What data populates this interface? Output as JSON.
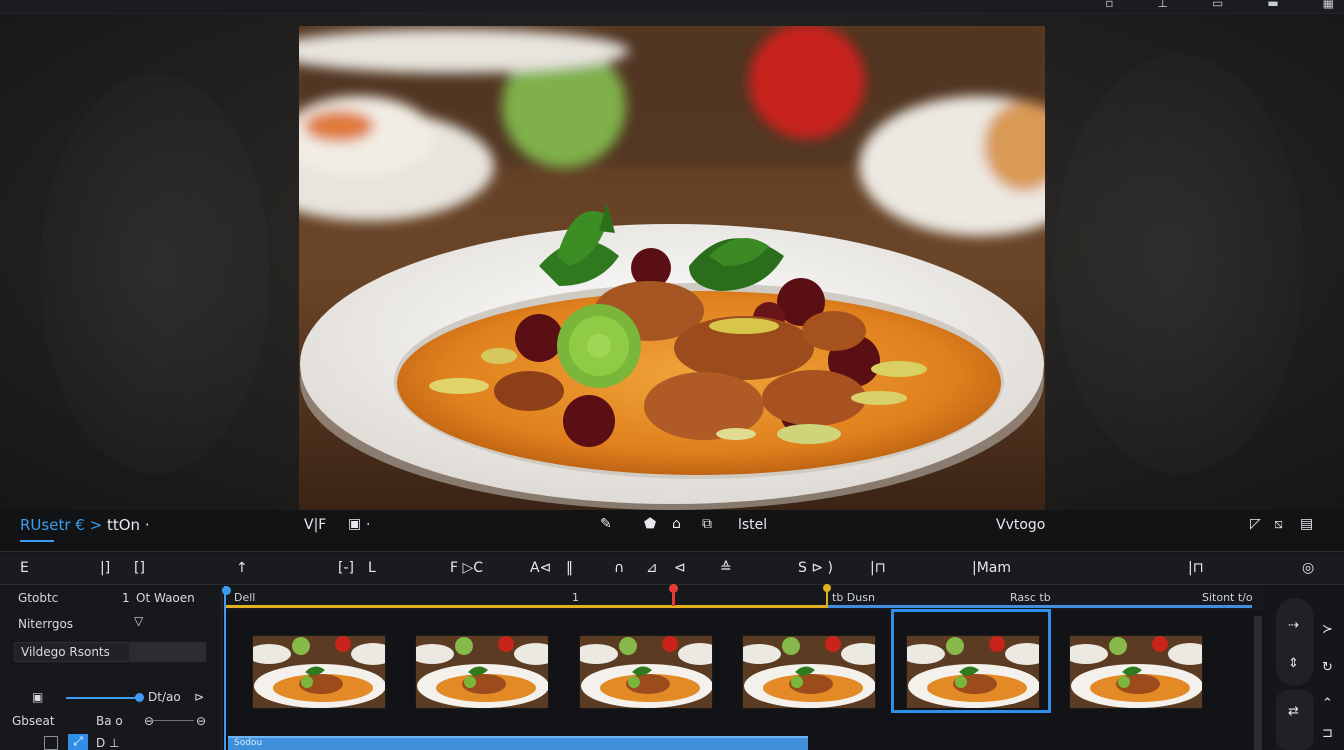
{
  "topbar": {
    "icons": [
      "window-icon",
      "pin-icon",
      "layout-icon",
      "panel-icon",
      "grid-icon"
    ]
  },
  "controls": {
    "breadcrumb_project": "RUsetr",
    "breadcrumb_sep": "€ >",
    "breadcrumb_item": "ttOn",
    "breadcrumb_dot": "·",
    "view_label": "V|F",
    "trash_label": "·",
    "mode_label": "lstel",
    "video_label": "Vvtogo"
  },
  "toolbar": {
    "items": [
      "E",
      "|]",
      "[]",
      "↑",
      "[-]",
      "L",
      "F ▷C",
      "A⊲",
      "‖",
      "∩",
      "⊿",
      "⊲",
      "≙",
      "S ⊳ )",
      "|⊓",
      "|Mam",
      "|⊓"
    ]
  },
  "left_panel": {
    "row1_label": "Gtobtc",
    "row1_mid": "1",
    "row1_value": "Ot   Waoen",
    "row2_label": "Niterrgos",
    "row3_label": "Vildego Rsonts",
    "row4_label": "Dt/ao",
    "row4_end": "⊳",
    "row5_label": "Gbseat",
    "row5_value": "Ba o",
    "row6_label": "D ⊥"
  },
  "timeline": {
    "ruler_start": "Dell",
    "ruler_mark": "1",
    "ruler_right1": "tb Dusn",
    "ruler_right2": "Rasc  tb",
    "ruler_right3": "Sitont  t/o",
    "clip_count": 6,
    "selected_clip_index": 4,
    "bottom_track_label": "Sodou"
  },
  "right_dock": {
    "icons": [
      "cursor-icon",
      "expand-icon",
      "share-icon",
      "export-icon"
    ]
  },
  "colors": {
    "accent": "#3d9bf0",
    "marker_red": "#e53935",
    "marker_yellow": "#e0b020",
    "selection": "#2f8fe8"
  }
}
